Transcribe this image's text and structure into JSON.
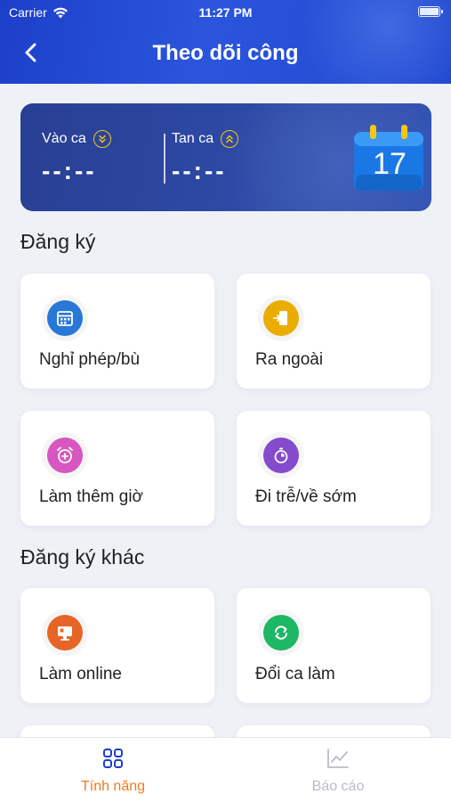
{
  "status_bar": {
    "carrier": "Carrier",
    "time": "11:27 PM"
  },
  "header": {
    "title": "Theo dõi công",
    "back_icon": "chevron-left-icon"
  },
  "shift": {
    "check_in": {
      "label": "Vào ca",
      "time": "--:--"
    },
    "check_out": {
      "label": "Tan ca",
      "time": "--:--"
    },
    "calendar_day": "17"
  },
  "sections": {
    "register": {
      "title": "Đăng ký",
      "items": [
        {
          "label": "Nghỉ phép/bù",
          "icon": "calendar-icon",
          "color": "#2a7de1"
        },
        {
          "label": "Ra ngoài",
          "icon": "exit-door-icon",
          "color": "#f5b400"
        },
        {
          "label": "Làm thêm giờ",
          "icon": "alarm-clock-icon",
          "color": "#e05ac8"
        },
        {
          "label": "Đi trễ/về sớm",
          "icon": "timer-icon",
          "color": "#8a4fd6"
        }
      ]
    },
    "other": {
      "title": "Đăng ký khác",
      "items": [
        {
          "label": "Làm online",
          "icon": "monitor-icon",
          "color": "#f06a28"
        },
        {
          "label": "Đổi ca làm",
          "icon": "swap-icon",
          "color": "#1fbf6a"
        }
      ]
    }
  },
  "bottom_nav": {
    "features": {
      "label": "Tính năng",
      "icon": "grid-icon",
      "color": "#f07a1e"
    },
    "reports": {
      "label": "Báo cáo",
      "icon": "line-chart-icon",
      "color": "#b7bcc6"
    }
  }
}
